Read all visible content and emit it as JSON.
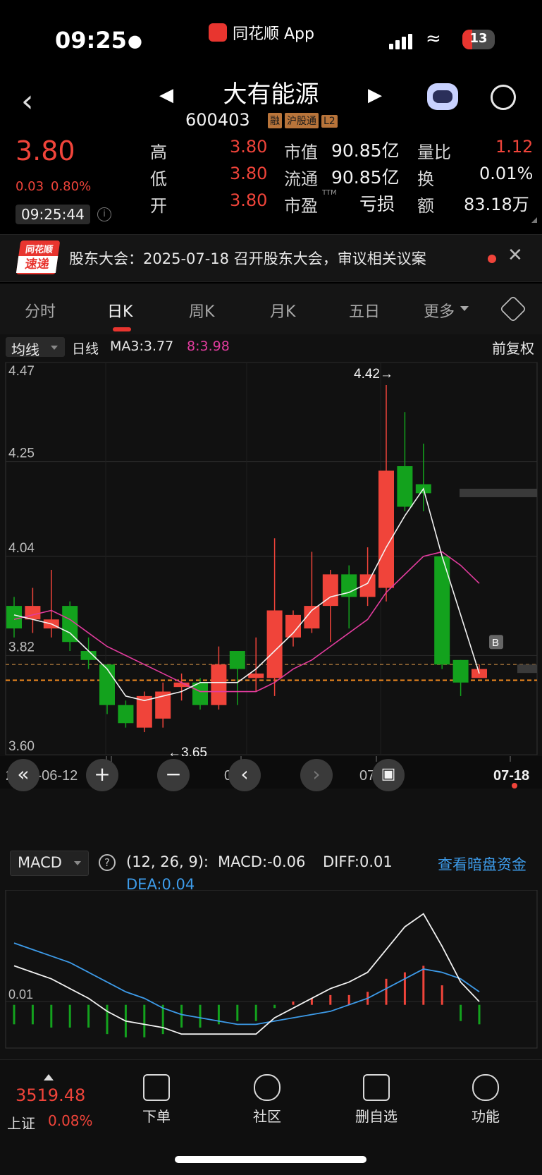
{
  "status_bar": {
    "time": "09:25",
    "app_name": "同花顺 App",
    "battery": "13"
  },
  "header": {
    "title": "大有能源",
    "code": "600403",
    "tags": [
      "融",
      "沪股通",
      "L2"
    ]
  },
  "quote": {
    "price": "3.80",
    "change": "0.03",
    "change_pct": "0.80%",
    "timestamp": "09:25:44",
    "high_label": "高",
    "high": "3.80",
    "low_label": "低",
    "low": "3.80",
    "open_label": "开",
    "open": "3.80",
    "mcap_label": "市值",
    "mcap": "90.85亿",
    "float_label": "流通",
    "float": "90.85亿",
    "pe_label": "市盈",
    "pe_sup": "TTM",
    "pe": "亏损",
    "vr_label": "量比",
    "vr": "1.12",
    "turn_label": "换",
    "turn": "0.01%",
    "amt_label": "额",
    "amt": "83.18万"
  },
  "news": {
    "logo_top": "同花顺",
    "logo_bottom": "速递",
    "text": "股东大会：2025-07-18 召开股东大会，审议相关议案"
  },
  "tabs": [
    "分时",
    "日K",
    "周K",
    "月K",
    "五日",
    "更多"
  ],
  "active_tab": "日K",
  "ma_bar": {
    "dropdown": "均线",
    "period": "日线",
    "ma3": "MA3:3.77",
    "ma8": "8:3.98",
    "adjust": "前复权"
  },
  "chart_data": [
    {
      "type": "candlestick",
      "y_ticks": [
        "4.47",
        "4.25",
        "4.04",
        "3.82",
        "3.60"
      ],
      "ylim": [
        3.6,
        4.47
      ],
      "x_ticks": [
        "2025-06-12",
        "6-19",
        "06-30",
        "07-09",
        "07-18"
      ],
      "annotations": {
        "max": "4.42→",
        "min": "←3.65",
        "marker": "B"
      },
      "candles": [
        {
          "o": 3.93,
          "c": 3.88,
          "h": 3.95,
          "l": 3.86
        },
        {
          "o": 3.9,
          "c": 3.93,
          "h": 3.97,
          "l": 3.87
        },
        {
          "o": 3.88,
          "c": 3.9,
          "h": 4.01,
          "l": 3.86
        },
        {
          "o": 3.93,
          "c": 3.85,
          "h": 3.94,
          "l": 3.83
        },
        {
          "o": 3.83,
          "c": 3.81,
          "h": 3.86,
          "l": 3.79
        },
        {
          "o": 3.8,
          "c": 3.71,
          "h": 3.8,
          "l": 3.69
        },
        {
          "o": 3.71,
          "c": 3.67,
          "h": 3.72,
          "l": 3.66
        },
        {
          "o": 3.66,
          "c": 3.73,
          "h": 3.74,
          "l": 3.65
        },
        {
          "o": 3.68,
          "c": 3.74,
          "h": 3.76,
          "l": 3.66
        },
        {
          "o": 3.75,
          "c": 3.76,
          "h": 3.78,
          "l": 3.72
        },
        {
          "o": 3.76,
          "c": 3.71,
          "h": 3.77,
          "l": 3.7
        },
        {
          "o": 3.71,
          "c": 3.8,
          "h": 3.84,
          "l": 3.7
        },
        {
          "o": 3.83,
          "c": 3.79,
          "h": 3.83,
          "l": 3.71
        },
        {
          "o": 3.77,
          "c": 3.78,
          "h": 3.86,
          "l": 3.74
        },
        {
          "o": 3.77,
          "c": 3.92,
          "h": 4.08,
          "l": 3.73
        },
        {
          "o": 3.86,
          "c": 3.91,
          "h": 3.92,
          "l": 3.84
        },
        {
          "o": 3.88,
          "c": 3.93,
          "h": 4.05,
          "l": 3.87
        },
        {
          "o": 3.93,
          "c": 4.0,
          "h": 4.01,
          "l": 3.85
        },
        {
          "o": 4.0,
          "c": 3.95,
          "h": 4.02,
          "l": 3.88
        },
        {
          "o": 3.95,
          "c": 4.0,
          "h": 4.06,
          "l": 3.93
        },
        {
          "o": 3.97,
          "c": 4.23,
          "h": 4.42,
          "l": 3.94
        },
        {
          "o": 4.24,
          "c": 4.15,
          "h": 4.36,
          "l": 4.14
        },
        {
          "o": 4.2,
          "c": 4.18,
          "h": 4.29,
          "l": 4.14
        },
        {
          "o": 4.04,
          "c": 3.8,
          "h": 4.04,
          "l": 3.79
        },
        {
          "o": 3.81,
          "c": 3.76,
          "h": 3.81,
          "l": 3.73
        },
        {
          "o": 3.77,
          "c": 3.79,
          "h": 3.8,
          "l": 3.77
        }
      ],
      "ma3": [
        3.91,
        3.9,
        3.89,
        3.87,
        3.83,
        3.79,
        3.73,
        3.72,
        3.73,
        3.74,
        3.76,
        3.76,
        3.76,
        3.79,
        3.83,
        3.87,
        3.92,
        3.95,
        3.96,
        3.98,
        4.06,
        4.13,
        4.19,
        4.04,
        3.91,
        3.78
      ],
      "ma8": [
        3.9,
        3.91,
        3.92,
        3.9,
        3.87,
        3.84,
        3.82,
        3.8,
        3.78,
        3.76,
        3.74,
        3.74,
        3.74,
        3.74,
        3.76,
        3.79,
        3.81,
        3.84,
        3.87,
        3.9,
        3.96,
        4.0,
        4.04,
        4.05,
        4.02,
        3.98
      ],
      "price_line": 3.8,
      "ref_line": 3.765,
      "grid": true
    },
    {
      "type": "bar+line",
      "indicator": "MACD",
      "params": "(12, 26, 9):",
      "macd_label": "MACD:-0.06",
      "diff_label": "DIFF:0.01",
      "dea_label": "DEA:0.04",
      "y_tick": "0.01",
      "link": "查看暗盘资金",
      "macd": [
        -0.06,
        -0.06,
        -0.07,
        -0.07,
        -0.07,
        -0.09,
        -0.1,
        -0.1,
        -0.09,
        -0.07,
        -0.07,
        -0.06,
        -0.05,
        -0.05,
        -0.01,
        0.01,
        0.02,
        0.03,
        0.03,
        0.04,
        0.08,
        0.1,
        0.12,
        0.06,
        -0.05,
        -0.06
      ],
      "diff": [
        0.12,
        0.1,
        0.08,
        0.05,
        0.02,
        -0.02,
        -0.05,
        -0.06,
        -0.07,
        -0.09,
        -0.09,
        -0.09,
        -0.09,
        -0.09,
        -0.04,
        -0.01,
        0.02,
        0.05,
        0.07,
        0.1,
        0.17,
        0.24,
        0.28,
        0.18,
        0.07,
        0.01
      ],
      "dea": [
        0.19,
        0.17,
        0.15,
        0.13,
        0.1,
        0.07,
        0.04,
        0.02,
        -0.01,
        -0.03,
        -0.04,
        -0.05,
        -0.06,
        -0.06,
        -0.05,
        -0.04,
        -0.03,
        -0.02,
        0.0,
        0.02,
        0.05,
        0.08,
        0.11,
        0.1,
        0.08,
        0.04
      ]
    }
  ],
  "chart_buttons": {
    "collapse": "«",
    "zoom_in": "+",
    "zoom_out": "−",
    "prev": "‹",
    "next": "›"
  },
  "bottom": {
    "index_value": "3519.48",
    "index_name": "上证",
    "index_pct": "0.08%",
    "nav": [
      "下单",
      "社区",
      "删自选",
      "功能"
    ]
  },
  "colors": {
    "up": "#f0443a",
    "down": "#13a21d",
    "ma3": "#f2f2f2",
    "ma8": "#e23c9e",
    "dea": "#3d9be9",
    "link": "#3d9be9"
  }
}
